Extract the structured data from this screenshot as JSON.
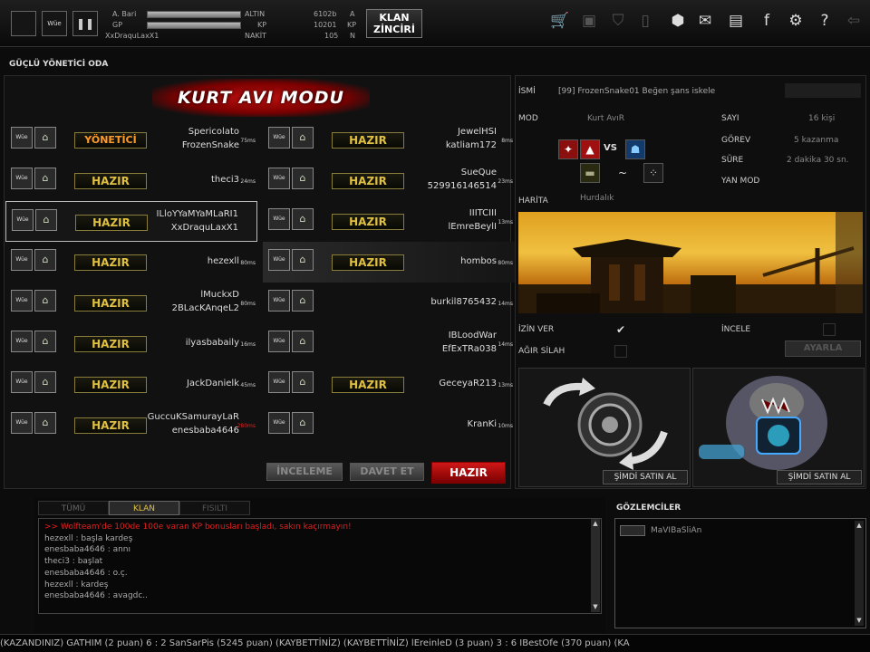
{
  "topbar": {
    "stat_labels": [
      "A. Bari",
      "GP",
      "XxDraquLaxX1"
    ],
    "stat_labels2": [
      "ALTIN",
      "KP",
      "NAKİT"
    ],
    "stat_vals": [
      "6102b",
      "10201",
      "105"
    ],
    "stat_units": [
      "A",
      "KP",
      "N"
    ],
    "klan_line1": "KLAN",
    "klan_line2": "ZİNCİRİ",
    "btn_small": "Wüe"
  },
  "room_title": "GÜÇLÜ YÖNETİCİ ODA",
  "mode_banner": "KURT AVI MODU",
  "left_slots": [
    {
      "status": "YÖNETİCİ",
      "name1": "Spericolato",
      "name2": "FrozenSnake",
      "ping": "75"
    },
    {
      "status": "HAZIR",
      "name1": "",
      "name2": "theci3",
      "ping": "24"
    },
    {
      "status": "HAZIR",
      "name1": "ILloYYaMYaMLaRI1",
      "name2": "XxDraquLaxX1",
      "ping": ""
    },
    {
      "status": "HAZIR",
      "name1": "",
      "name2": "hezexll",
      "ping": "80"
    },
    {
      "status": "HAZIR",
      "name1": "lMuckxD",
      "name2": "2BLacKAnqeL2",
      "ping": "80"
    },
    {
      "status": "HAZIR",
      "name1": "",
      "name2": "ilyasbabaily",
      "ping": "16"
    },
    {
      "status": "HAZIR",
      "name1": "",
      "name2": "JackDanielk",
      "ping": "45"
    },
    {
      "status": "HAZIR",
      "name1": "GuccuKSamurayLaR",
      "name2": "enesbaba4646",
      "ping": "280"
    }
  ],
  "right_slots": [
    {
      "status": "HAZIR",
      "name1": "JewelHSI",
      "name2": "katliam172",
      "ping": "8"
    },
    {
      "status": "HAZIR",
      "name1": "SueQue",
      "name2": "529916146514",
      "ping": "23"
    },
    {
      "status": "HAZIR",
      "name1": "IIITCIII",
      "name2": "lEmreBeylI",
      "ping": "13"
    },
    {
      "status": "HAZIR",
      "name1": "",
      "name2": "hombos",
      "ping": "80"
    },
    {
      "status": "",
      "name1": "",
      "name2": "burkil8765432",
      "ping": "14"
    },
    {
      "status": "",
      "name1": "IBLoodWar",
      "name2": "EfExTRa038",
      "ping": "14"
    },
    {
      "status": "HAZIR",
      "name1": "",
      "name2": "GeceyaR213",
      "ping": "13"
    },
    {
      "status": "",
      "name1": "",
      "name2": "KranKi",
      "ping": "10"
    }
  ],
  "ping_unit": "ms",
  "bottom_buttons": {
    "inceleme": "İNCELEME",
    "davet": "DAVET ET",
    "hazir": "HAZIR"
  },
  "room_info": {
    "isim_label": "İSMİ",
    "isim_value": "[99] FrozenSnake01 Beğen şans iskele",
    "mod_label": "MOD",
    "mod_value": "Kurt AvıR",
    "vs": "VS",
    "harita_label": "HARİTA",
    "harita_value": "Hurdalık",
    "sayi_label": "SAYI",
    "sayi_value": "16 kişi",
    "gorev_label": "GÖREV",
    "gorev_value": "5 kazanma",
    "sure_label": "SÜRE",
    "sure_value": "2 dakika 30 sn.",
    "yanmod_label": "YAN MOD",
    "izin_label": "İZİN VER",
    "agir_label": "AĞIR SİLAH",
    "incele_label": "İNCELE",
    "ayarla": "AYARLA"
  },
  "shop": {
    "btn1": "ŞİMDİ SATIN AL",
    "btn2": "ŞİMDİ SATIN AL"
  },
  "chat": {
    "tabs": [
      "TÜMÜ",
      "KLAN",
      "FISILTI"
    ],
    "system_msg": ">> Wolfteam'de 100de 100e varan KP bonusları başladı, sakın kaçırmayın!",
    "lines": [
      "hezexll : başla kardeş",
      "enesbaba4646 : annı",
      "theci3 : başlat",
      "enesbaba4646 : o.ç.",
      "hezexll : kardeş",
      "enesbaba4646 : avagdc.."
    ]
  },
  "observers": {
    "title": "GÖZLEMCİLER",
    "items": [
      "MaVIBaSliAn"
    ]
  },
  "ticker": "(KAZANDINIZ) GATHIM (2 puan) 6 : 2 SanSarPis (5245 puan) (KAYBETTİNİZ)          (KAYBETTİNİZ) lEreinleD (3 puan) 3 : 6 IBestOfe (370 puan) (KA",
  "colors": {
    "accent_red": "#d01818",
    "status_gold": "#e0c040",
    "admin_orange": "#ff9a2a"
  }
}
